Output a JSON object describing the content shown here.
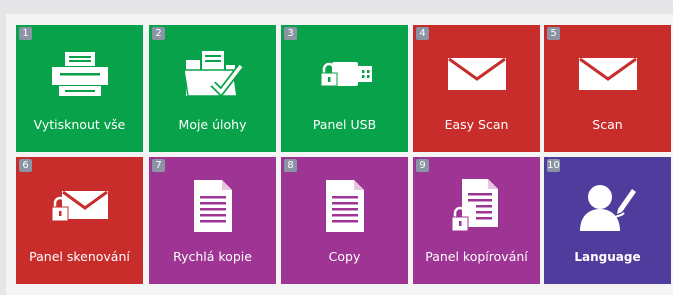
{
  "tiles": [
    {
      "number": "1",
      "label": "Vytisknout vše",
      "icon": "printer-icon",
      "color": "#08a24a"
    },
    {
      "number": "2",
      "label": "Moje úlohy",
      "icon": "folder-check-icon",
      "color": "#08a24a"
    },
    {
      "number": "3",
      "label": "Panel USB",
      "icon": "usb-lock-icon",
      "color": "#08a24a"
    },
    {
      "number": "4",
      "label": "Easy Scan",
      "icon": "envelope-icon",
      "color": "#c82d2b"
    },
    {
      "number": "5",
      "label": "Scan",
      "icon": "envelope-icon",
      "color": "#c82d2b"
    },
    {
      "number": "6",
      "label": "Panel skenování",
      "icon": "envelope-lock-icon",
      "color": "#c82d2b"
    },
    {
      "number": "7",
      "label": "Rychlá kopie",
      "icon": "document-icon",
      "color": "#9e3594"
    },
    {
      "number": "8",
      "label": "Copy",
      "icon": "document-icon",
      "color": "#9e3594"
    },
    {
      "number": "9",
      "label": "Panel kopírování",
      "icon": "document-lock-icon",
      "color": "#9e3594"
    },
    {
      "number": "10",
      "label": "Language",
      "icon": "user-edit-icon",
      "color": "#4f3c9c"
    }
  ]
}
